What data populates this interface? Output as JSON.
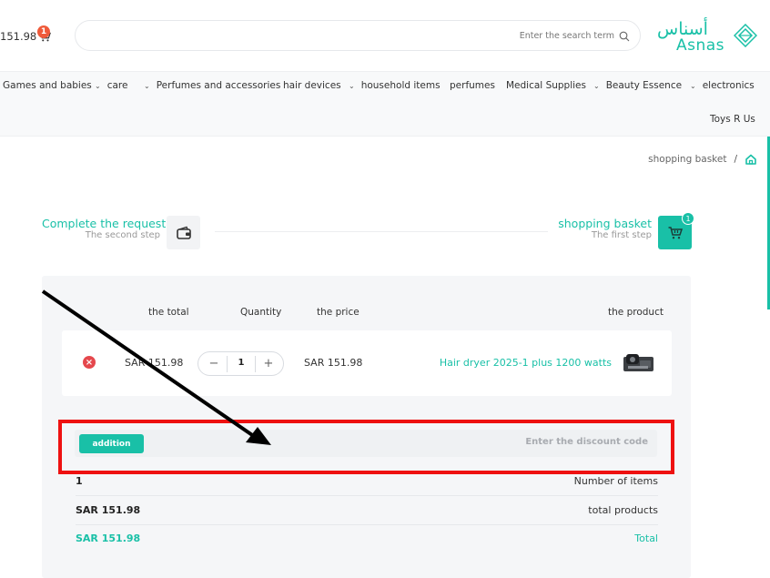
{
  "header": {
    "cart_amount": "151.98",
    "cart_badge": "1",
    "search_placeholder": "Enter the search term",
    "logo_arabic": "أسناس",
    "logo_english": "Asnas"
  },
  "nav": {
    "items": [
      {
        "label": "Games and babies",
        "dropdown": false
      },
      {
        "label": "care",
        "dropdown": true
      },
      {
        "label": "Perfumes and accessories",
        "dropdown": true
      },
      {
        "label": "hair devices",
        "dropdown": false
      },
      {
        "label": "household items",
        "dropdown": true
      },
      {
        "label": "perfumes",
        "dropdown": false
      },
      {
        "label": "Medical Supplies",
        "dropdown": false
      },
      {
        "label": "Beauty Essence",
        "dropdown": true
      },
      {
        "label": "electronics",
        "dropdown": true
      },
      {
        "label": "Toys R Us",
        "dropdown": false
      }
    ]
  },
  "breadcrumb": {
    "current": "shopping basket",
    "separator": "/"
  },
  "steps": {
    "step1_title": "shopping basket",
    "step1_sub": "The first step",
    "step1_badge": "1",
    "step2_title": "Complete the request",
    "step2_sub": "The second step"
  },
  "table": {
    "headers": {
      "total": "the total",
      "quantity": "Quantity",
      "price": "the price",
      "product": "the product"
    },
    "rows": [
      {
        "total": "SAR 151.98",
        "quantity": "1",
        "price": "SAR 151.98",
        "product": "Hair dryer 2025-1 plus 1200 watts"
      }
    ]
  },
  "discount": {
    "button_label": "addition",
    "placeholder": "Enter the discount code"
  },
  "summary": {
    "items_count_value": "1",
    "items_count_label": "Number of items",
    "products_total_value": "SAR 151.98",
    "products_total_label": "total products",
    "grand_total_value": "SAR 151.98",
    "grand_total_label": "Total"
  },
  "colors": {
    "accent": "#19c0a7",
    "highlight": "#ee1111",
    "remove": "#e5484d",
    "badge": "#ef5a3a"
  },
  "icons": [
    "cart-icon",
    "search-icon",
    "logo-mark-icon",
    "home-icon",
    "wallet-icon",
    "close-icon",
    "plus-icon",
    "minus-icon"
  ]
}
